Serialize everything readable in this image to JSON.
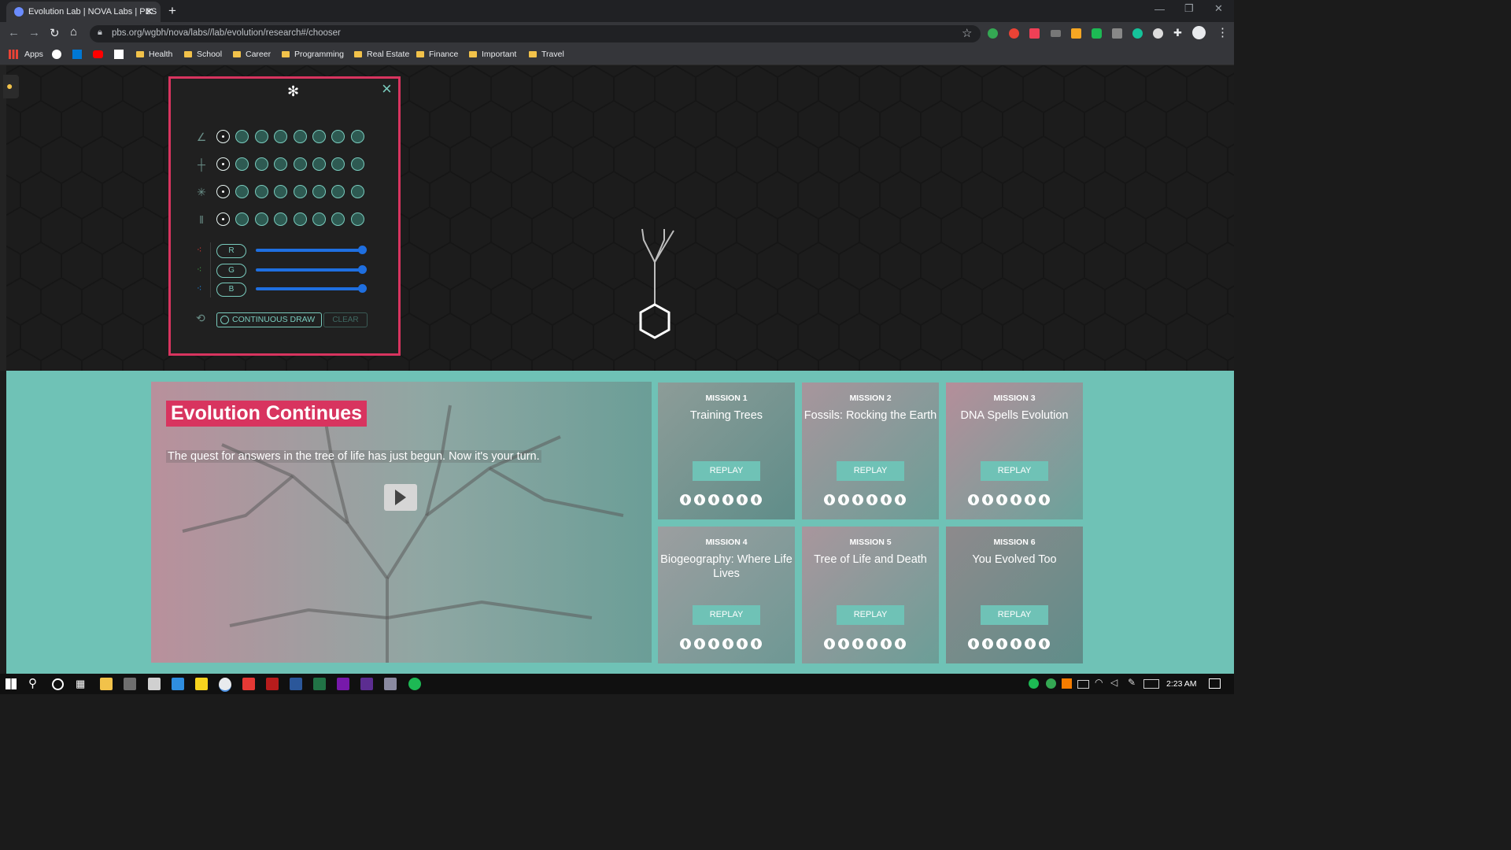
{
  "browser": {
    "tab_title": "Evolution Lab | NOVA Labs | PBS",
    "new_tab": "+",
    "url": "pbs.org/wgbh/nova/labs//lab/evolution/research#/chooser",
    "bookmarks": [
      "Apps",
      "Health",
      "School",
      "Career",
      "Programming",
      "Real Estate",
      "Finance",
      "Important",
      "Travel"
    ]
  },
  "panel": {
    "close": "×",
    "sliders": [
      "R",
      "G",
      "B"
    ],
    "continuous_draw": "CONTINUOUS DRAW",
    "clear": "CLEAR",
    "slider_values": [
      1,
      1,
      1
    ]
  },
  "hero": {
    "title": "Evolution Continues",
    "subtitle": "The quest for answers in the tree of life has just begun. Now it's your turn."
  },
  "missions": [
    {
      "label": "MISSION 1",
      "title": "Training Trees",
      "button": "REPLAY",
      "stars": 6
    },
    {
      "label": "MISSION 2",
      "title": "Fossils: Rocking the Earth",
      "button": "REPLAY",
      "stars": 6
    },
    {
      "label": "MISSION 3",
      "title": "DNA Spells Evolution",
      "button": "REPLAY",
      "stars": 6
    },
    {
      "label": "MISSION 4",
      "title": "Biogeography: Where Life Lives",
      "button": "REPLAY",
      "stars": 6
    },
    {
      "label": "MISSION 5",
      "title": "Tree of Life and Death",
      "button": "REPLAY",
      "stars": 6
    },
    {
      "label": "MISSION 6",
      "title": "You Evolved Too",
      "button": "REPLAY",
      "stars": 6
    }
  ],
  "taskbar": {
    "time": "2:23 AM"
  },
  "colors": {
    "accent_pink": "#d8345f",
    "teal": "#6fc2b6",
    "slider_blue": "#1f6fe0"
  }
}
